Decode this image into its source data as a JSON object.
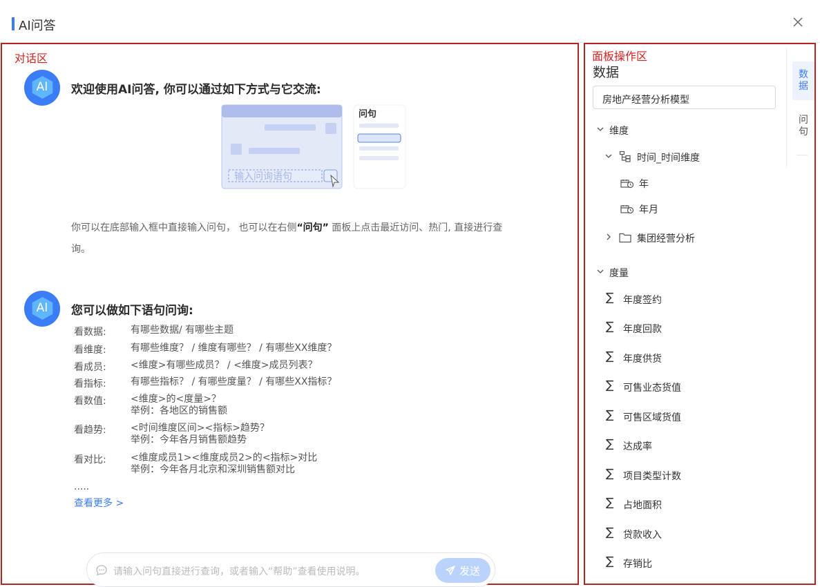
{
  "window": {
    "title": "AI问答"
  },
  "annotations": {
    "conversation_area": "对话区",
    "panel_area": "面板操作区"
  },
  "welcome": {
    "avatar_text": "AI",
    "heading": "欢迎使用AI问答, 你可以通过如下方式与它交流:",
    "illustration": {
      "input_placeholder": "输入问询语句",
      "side_title": "问句"
    },
    "desc_part1": "你可以在底部输入框中直接输入问句， 也可以在右侧",
    "desc_bold": "“问句”",
    "desc_part2": " 面板上点击最近访问、热门, 直接进行查",
    "desc_line2": "询。"
  },
  "examples": {
    "avatar_text": "AI",
    "heading": "您可以做如下语句问询:",
    "rows": [
      {
        "key": "看数据:",
        "value": "有哪些数据/ 有哪些主题"
      },
      {
        "key": "看维度:",
        "value": "有哪些维度？ / 维度有哪些？ / 有哪些XX维度？"
      },
      {
        "key": "看成员:",
        "value": "<维度>有哪些成员？ / <维度>成员列表？"
      },
      {
        "key": "看指标:",
        "value": "有哪些指标？ / 有哪些度量？ / 有哪些XX指标？"
      },
      {
        "key": "看数值:",
        "value": "<维度>的<度量>？",
        "example": "举例：各地区的销售额"
      },
      {
        "key": "看趋势:",
        "value": "<时间维度区间><指标>趋势？",
        "example": "举例：今年各月销售额趋势"
      },
      {
        "key": "看对比:",
        "value": "<维度成员1><维度成员2>的<指标>对比",
        "example": "举例：今年各月北京和深圳销售额对比"
      }
    ],
    "ellipsis": ".....",
    "more_link": "查看更多 >"
  },
  "input": {
    "placeholder": "请输入问句直接进行查询，或者输入“帮助”查看使用说明。",
    "send_label": "发送"
  },
  "panel": {
    "title": "数据",
    "model": "房地产经营分析模型",
    "dimension_group": "维度",
    "time_dim": "时间_时间维度",
    "time_members": [
      "年",
      "年月"
    ],
    "folder": "集团经营分析",
    "measure_group": "度量",
    "measures": [
      "年度签约",
      "年度回款",
      "年度供货",
      "可售业态货值",
      "可售区域货值",
      "达成率",
      "项目类型计数",
      "占地面积",
      "贷款收入",
      "存销比"
    ]
  },
  "side_tabs": [
    {
      "label": "数据",
      "active": true
    },
    {
      "label": "问句",
      "active": false
    }
  ],
  "colors": {
    "accent": "#3b7cf7",
    "annotation": "#d0231f",
    "send_disabled": "#b9d3fc"
  }
}
